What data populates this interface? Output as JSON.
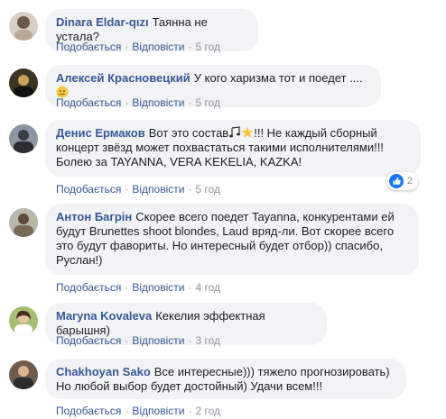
{
  "actions": {
    "like": "Подобається",
    "reply": "Відповісти",
    "separator": "·"
  },
  "comments": [
    {
      "author": "Dinara Eldar-qızı",
      "text": "Таянна не устала?",
      "time": "5 год"
    },
    {
      "author": "Алексей Красновецкий",
      "text": "У кого харизма тот и поедет ....",
      "time": "5 год",
      "emoji": "thinking-face"
    },
    {
      "author": "Денис Ермаков",
      "text_part1": "Вот это состав",
      "text_part2": "!!! Не каждый сборный концерт звёзд может похвастаться такими исполнителями!!! Болею за TAYANNA, VERA KEKELIA, KAZKA!",
      "time": "5 год",
      "emoji": [
        "musical-notes",
        "star"
      ],
      "reaction_count": "2"
    },
    {
      "author": "Антон Багрін",
      "text": "Скорее всего поедет Tayanna, конкурентами ей будут Brunettes shoot blondes, Laud вряд-ли. Вот скорее всего это будут фавориты. Но интересный будет отбор)) спасибо, Руслан!)",
      "time": "4 год"
    },
    {
      "author": "Maryna Kovaleva",
      "text": "Кекелия эффектная барышня)",
      "time": "3 год"
    },
    {
      "author": "Chakhoyan Sako",
      "text": "Все интересные))) тяжело прогнозировать) Но любой выбор будет достойный) Удачи всем!!!",
      "time": "2 год"
    }
  ],
  "colors": {
    "author": "#385898",
    "bubble": "#f2f3f5",
    "meta": "#90949c",
    "like_badge": "#1877f2"
  }
}
